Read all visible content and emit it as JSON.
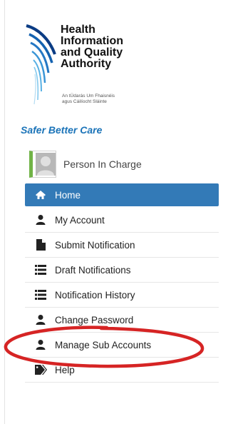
{
  "brand": {
    "title_lines": [
      "Health",
      "Information",
      "and Quality",
      "Authority"
    ],
    "subtitle_lines": [
      "An tÚdarás Um Fhaisnéis",
      "agus Cáilíocht Sláinte"
    ],
    "tagline": "Safer Better Care",
    "primary_color": "#1a73b8"
  },
  "user": {
    "role_label": "Person In Charge",
    "avatar_accent": "#71b347"
  },
  "menu": {
    "items": [
      {
        "label": "Home",
        "icon": "home-icon",
        "active": true
      },
      {
        "label": "My Account",
        "icon": "user-icon",
        "active": false
      },
      {
        "label": "Submit Notification",
        "icon": "file-icon",
        "active": false
      },
      {
        "label": "Draft Notifications",
        "icon": "list-icon",
        "active": false
      },
      {
        "label": "Notification History",
        "icon": "list-icon",
        "active": false
      },
      {
        "label": "Change Password",
        "icon": "user-icon",
        "active": false
      },
      {
        "label": "Manage Sub Accounts",
        "icon": "user-icon",
        "active": false
      },
      {
        "label": "Help",
        "icon": "tag-icon",
        "active": false
      }
    ],
    "active_color": "#337ab7",
    "highlight_color": "#d62424"
  }
}
